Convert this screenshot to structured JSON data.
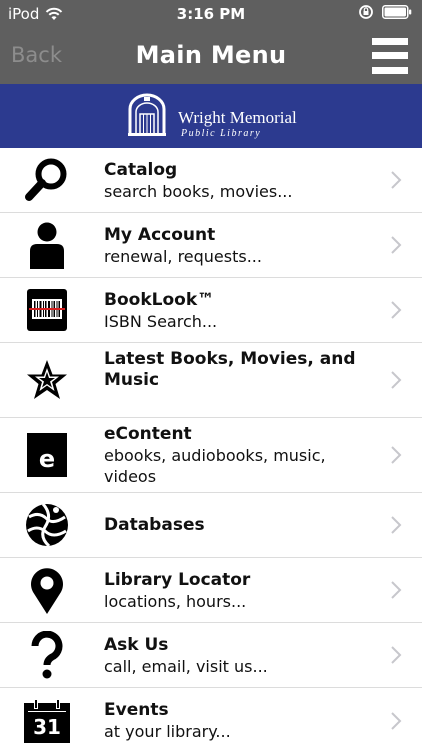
{
  "status_bar": {
    "carrier": "iPod",
    "time": "3:16 PM"
  },
  "nav": {
    "back_label": "Back",
    "title": "Main Menu"
  },
  "banner": {
    "name": "Wright Memorial",
    "subtitle": "Public Library"
  },
  "menu": {
    "items": [
      {
        "title": "Catalog",
        "subtitle": "search books, movies...",
        "icon": "search-icon"
      },
      {
        "title": "My Account",
        "subtitle": "renewal, requests...",
        "icon": "person-icon"
      },
      {
        "title": "BookLook™",
        "subtitle": "ISBN Search...",
        "icon": "barcode-icon"
      },
      {
        "title": "Latest Books, Movies, and Music",
        "subtitle": "",
        "icon": "star-icon"
      },
      {
        "title": "eContent",
        "subtitle": "ebooks, audiobooks, music, videos",
        "icon": "econtent-icon",
        "badge": "e"
      },
      {
        "title": "Databases",
        "subtitle": "",
        "icon": "globe-icon"
      },
      {
        "title": "Library Locator",
        "subtitle": "locations, hours...",
        "icon": "map-pin-icon"
      },
      {
        "title": "Ask Us",
        "subtitle": "call, email, visit us...",
        "icon": "question-icon"
      },
      {
        "title": "Events",
        "subtitle": "at your library...",
        "icon": "calendar-icon",
        "badge": "31"
      }
    ]
  },
  "colors": {
    "nav_bg": "#5f5f5f",
    "banner_bg": "#2c3a8f",
    "chevron": "#c7c7cc"
  }
}
